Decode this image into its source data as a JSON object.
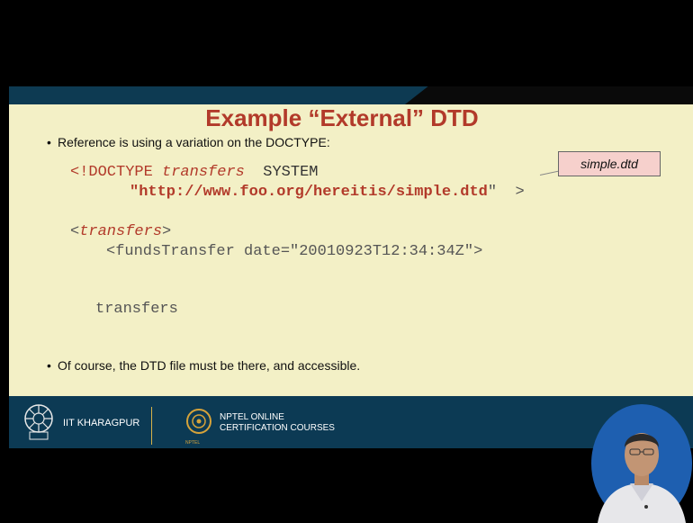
{
  "slide": {
    "title": "Example “External” DTD",
    "bullet1": "Reference is using a variation on the DOCTYPE:",
    "bullet2": "Of course, the DTD file must be there, and accessible.",
    "code": {
      "line1_a": "<!DOCTYPE ",
      "line1_b": "transfers",
      "line1_c": "  SYSTEM",
      "line2_a": "\"http://www.foo.org/hereitis/simple.dtd",
      "line2_b": "\"  >",
      "line3_a": "<",
      "line3_b": "transfers",
      "line3_c": ">",
      "line4": "<fundsTransfer date=\"20010923T12:34:34Z\">",
      "line5": "transfers"
    },
    "callout": "simple.dtd"
  },
  "footer": {
    "iit": "IIT KHARAGPUR",
    "nptel_line1": "NPTEL ONLINE",
    "nptel_line2": "CERTIFICATION COURSES",
    "nptel_logo_text": "NPTEL"
  },
  "colors": {
    "accent": "#b23a2a",
    "slide_bg": "#f3f0c6",
    "footer_bg": "#0c3a54"
  }
}
